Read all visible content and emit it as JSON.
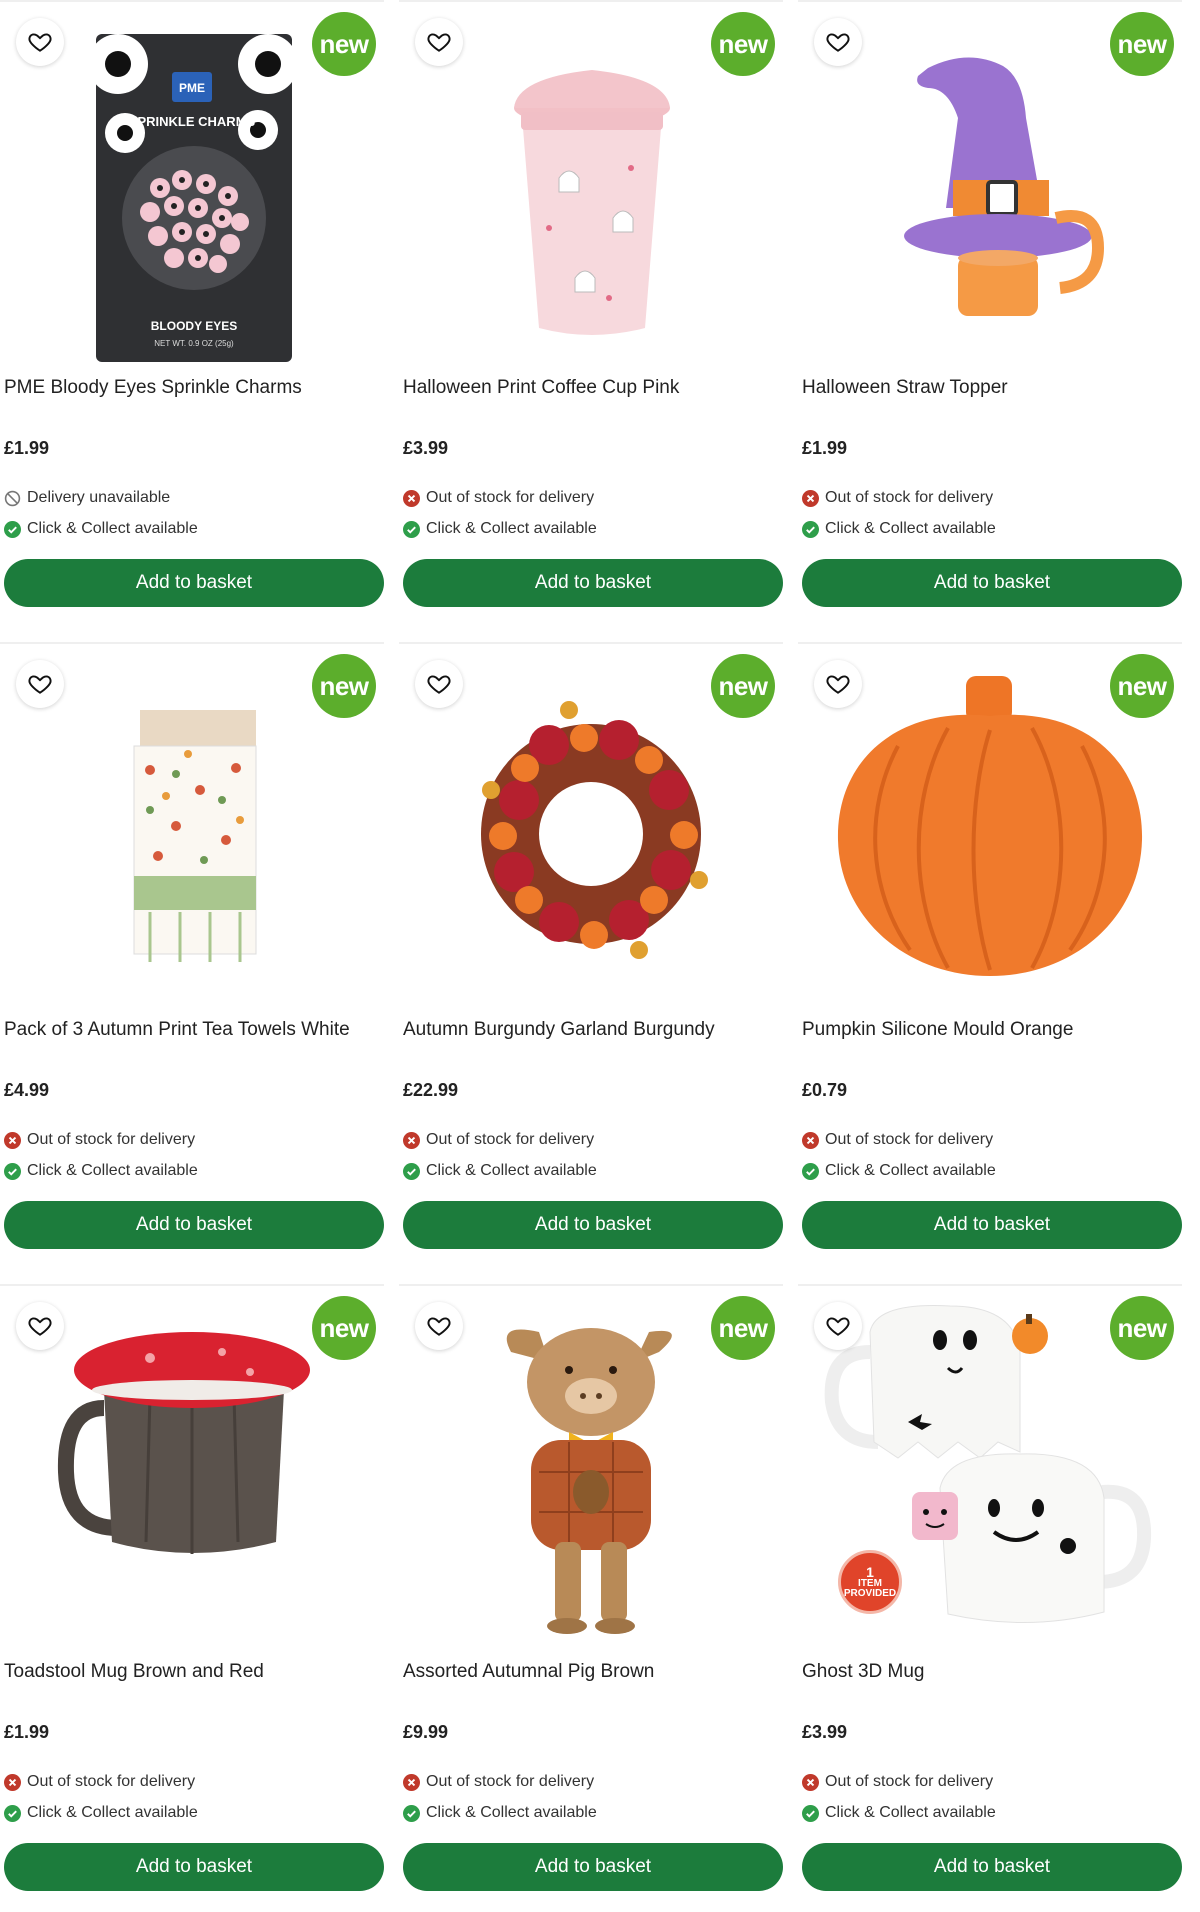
{
  "badge_label": "new",
  "button_label": "Add to basket",
  "colors": {
    "accent_green": "#1c7c3c",
    "new_badge": "#5cae2c",
    "error_red": "#c0392b",
    "ok_green": "#2e9e4a"
  },
  "products": [
    {
      "title": "PME Bloody Eyes Sprinkle Charms",
      "price": "£1.99",
      "delivery": "Delivery unavailable",
      "delivery_icon": "block-icon",
      "collect": "Click & Collect available",
      "image": "sprinkle-charms"
    },
    {
      "title": "Halloween Print Coffee Cup Pink",
      "price": "£3.99",
      "delivery": "Out of stock for delivery",
      "delivery_icon": "cross-icon",
      "collect": "Click & Collect available",
      "image": "coffee-cup"
    },
    {
      "title": "Halloween Straw Topper",
      "price": "£1.99",
      "delivery": "Out of stock for delivery",
      "delivery_icon": "cross-icon",
      "collect": "Click & Collect available",
      "image": "witch-hat"
    },
    {
      "title": "Pack of 3 Autumn Print Tea Towels White",
      "price": "£4.99",
      "delivery": "Out of stock for delivery",
      "delivery_icon": "cross-icon",
      "collect": "Click & Collect available",
      "image": "tea-towels"
    },
    {
      "title": "Autumn Burgundy Garland Burgundy",
      "price": "£22.99",
      "delivery": "Out of stock for delivery",
      "delivery_icon": "cross-icon",
      "collect": "Click & Collect available",
      "image": "wreath"
    },
    {
      "title": "Pumpkin Silicone Mould Orange",
      "price": "£0.79",
      "delivery": "Out of stock for delivery",
      "delivery_icon": "cross-icon",
      "collect": "Click & Collect available",
      "image": "pumpkin-mould"
    },
    {
      "title": "Toadstool Mug Brown and Red",
      "price": "£1.99",
      "delivery": "Out of stock for delivery",
      "delivery_icon": "cross-icon",
      "collect": "Click & Collect available",
      "image": "toadstool-mug"
    },
    {
      "title": "Assorted Autumnal Pig Brown",
      "price": "£9.99",
      "delivery": "Out of stock for delivery",
      "delivery_icon": "cross-icon",
      "collect": "Click & Collect available",
      "image": "straw-pig"
    },
    {
      "title": "Ghost 3D Mug",
      "price": "£3.99",
      "delivery": "Out of stock for delivery",
      "delivery_icon": "cross-icon",
      "collect": "Click & Collect available",
      "image": "ghost-mugs"
    }
  ],
  "packaging_text": {
    "brand": "PME",
    "product": "SPRINKLE CHARMS",
    "flavor": "BLOODY EYES",
    "weight": "NET WT. 0.9 OZ (25g)"
  },
  "item_provided": {
    "count": "1",
    "line1": "ITEM",
    "line2": "PROVIDED"
  }
}
